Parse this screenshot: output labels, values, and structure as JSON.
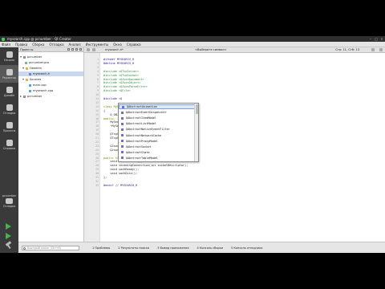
{
  "window": {
    "title": "mysearch.cpp @ pcnumber - Qt Creator"
  },
  "menu": [
    "Файл",
    "Правка",
    "Сборка",
    "Отладка",
    "Анализ",
    "Инструменты",
    "Окно",
    "Справка"
  ],
  "modes": [
    {
      "label": "Начало"
    },
    {
      "label": "Редактор"
    },
    {
      "label": "Дизайн"
    },
    {
      "label": "Отладка"
    },
    {
      "label": "Проекты"
    },
    {
      "label": "Справка"
    }
  ],
  "kit": {
    "name": "pcnumber",
    "config": "Отладка"
  },
  "project_panel": {
    "title": "Проекты",
    "tree": [
      {
        "label": "pcnumber",
        "depth": 0,
        "type": "project",
        "expanded": true
      },
      {
        "label": "pcnumber.pro",
        "depth": 1,
        "type": "pro",
        "expanded": false
      },
      {
        "label": "Headers",
        "depth": 1,
        "type": "folder",
        "expanded": true
      },
      {
        "label": "mysearch.h",
        "depth": 2,
        "type": "header",
        "expanded": false,
        "selected": true
      },
      {
        "label": "Sources",
        "depth": 1,
        "type": "folder",
        "expanded": true
      },
      {
        "label": "main.cpp",
        "depth": 2,
        "type": "source",
        "expanded": false
      },
      {
        "label": "mysearch.cpp",
        "depth": 2,
        "type": "source",
        "expanded": false
      },
      {
        "label": "pcnumber",
        "depth": 0,
        "type": "project",
        "expanded": false
      }
    ]
  },
  "editor": {
    "file": "mysearch.h*",
    "symbol": "<Выберите символ>",
    "position": "Стр: 11, Стб: 13",
    "lines": [
      "#ifndef MYSEARCH_H",
      "#define MYSEARCH_H",
      "",
      "#include <QTcpServer>",
      "#include <QTcpSocket>",
      "#include <QJsonDocument>",
      "#include <QJsonObject>",
      "#include <QJsonParseError>",
      "#include <QFile>",
      "",
      "#include <Q",
      "",
      "class MySea",
      "{",
      "    Q_OBJEC",
      "public:",
      "    MySear",
      "    ~MySear",
      "",
      "    QTcpSer",
      "    QTcpSoc",
      "",
      "    QJsonDo",
      "    QJsonPa",
      "",
      "public slots:",
      "    void startServer();",
      "    void incomingConnection(int socketDescriptor);",
      "    void sockReady();",
      "    void sockDisc();",
      "};",
      "",
      "#endif // MYSEARCH_H"
    ]
  },
  "completion": {
    "items": [
      "QAbstractAnimation",
      "QAbstractEventDispatcher",
      "QAbstractItemModel",
      "QAbstractListModel",
      "QAbstractNativeEventFilter",
      "QAbstractNetworkCache",
      "QAbstractProxyModel",
      "QAbstractSocket",
      "QAbstractState",
      "QAbstractTableModel"
    ]
  },
  "locator": {
    "placeholder": "Быстрый поиск (Ctrl+K)"
  },
  "output_tabs": [
    "1 Проблемы",
    "2 Результаты поиска",
    "3 Вывод приложения",
    "4 Консоль сборки",
    "5 Консоль отладчика"
  ]
}
